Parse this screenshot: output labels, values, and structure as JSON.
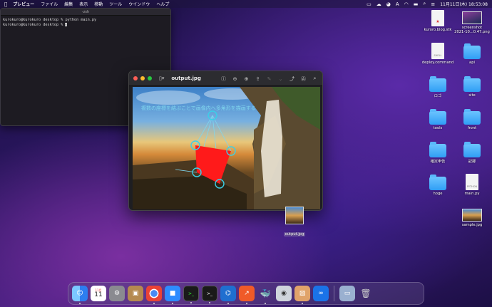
{
  "menubar": {
    "app_name": "プレビュー",
    "items": [
      "ファイル",
      "編集",
      "表示",
      "移動",
      "ツール",
      "ウインドウ",
      "ヘルプ"
    ],
    "clock": "11月11日(木) 18:53:08",
    "status_icons": [
      "control-center-icon",
      "screen-icon",
      "cloud-icon",
      "user-icon",
      "input-a-icon",
      "battery-icon",
      "wifi-icon",
      "volume-icon",
      "search-icon",
      "siri-icon"
    ]
  },
  "terminal": {
    "title": "-zsh",
    "lines": [
      "kurokuro@kurokuro desktop % python main.py",
      "kurokuro@kurokuro desktop % "
    ]
  },
  "preview": {
    "title": "output.jpg",
    "overlay_text": "複数の座標を結ぶことで画像内へ多角形を描画する",
    "tools": [
      "info-icon",
      "zoom-out-icon",
      "zoom-in-icon",
      "share-icon",
      "markup-icon",
      "chevron-down-icon",
      "rotate-icon",
      "annotate-icon",
      "search-icon"
    ]
  },
  "desktop": {
    "icons": [
      {
        "label": "kuroro.blog.stk",
        "kind": "file"
      },
      {
        "label": "screenshot\n2021-10...0.47.png",
        "kind": "thumb"
      },
      {
        "label": "deploy.command",
        "kind": "file"
      },
      {
        "label": "api",
        "kind": "folder"
      },
      {
        "label": "ロゴ",
        "kind": "folder"
      },
      {
        "label": "site",
        "kind": "folder"
      },
      {
        "label": "tools",
        "kind": "folder"
      },
      {
        "label": "front",
        "kind": "folder"
      },
      {
        "label": "確定申告",
        "kind": "folder"
      },
      {
        "label": "記録",
        "kind": "folder"
      },
      {
        "label": "hoge",
        "kind": "folder"
      },
      {
        "label": "main.py",
        "kind": "file"
      },
      {
        "label": "sample.jpg",
        "kind": "thumb"
      },
      {
        "label": "output.jpg",
        "kind": "thumb"
      }
    ],
    "file_badges": {
      "deploy": "SHELL",
      "main": "PYTHON"
    }
  },
  "dock": {
    "calendar_month": "11月",
    "calendar_day": "11",
    "apps": [
      "finder-icon",
      "calendar-icon",
      "system-preferences-icon",
      "contacts-icon",
      "chrome-icon",
      "zoom-icon",
      "terminal-icon",
      "terminal-icon",
      "vscode-icon",
      "stats-app-icon",
      "docker-icon",
      "screen-capture-icon",
      "preview-icon",
      "infinity-icon",
      "desktop-thumbnail-icon",
      "trash-icon"
    ]
  },
  "colors": {
    "polygon_fill": "#ff1a1a",
    "circle_stroke": "#3ad0e8",
    "overlay_text": "#7fd6ee"
  }
}
